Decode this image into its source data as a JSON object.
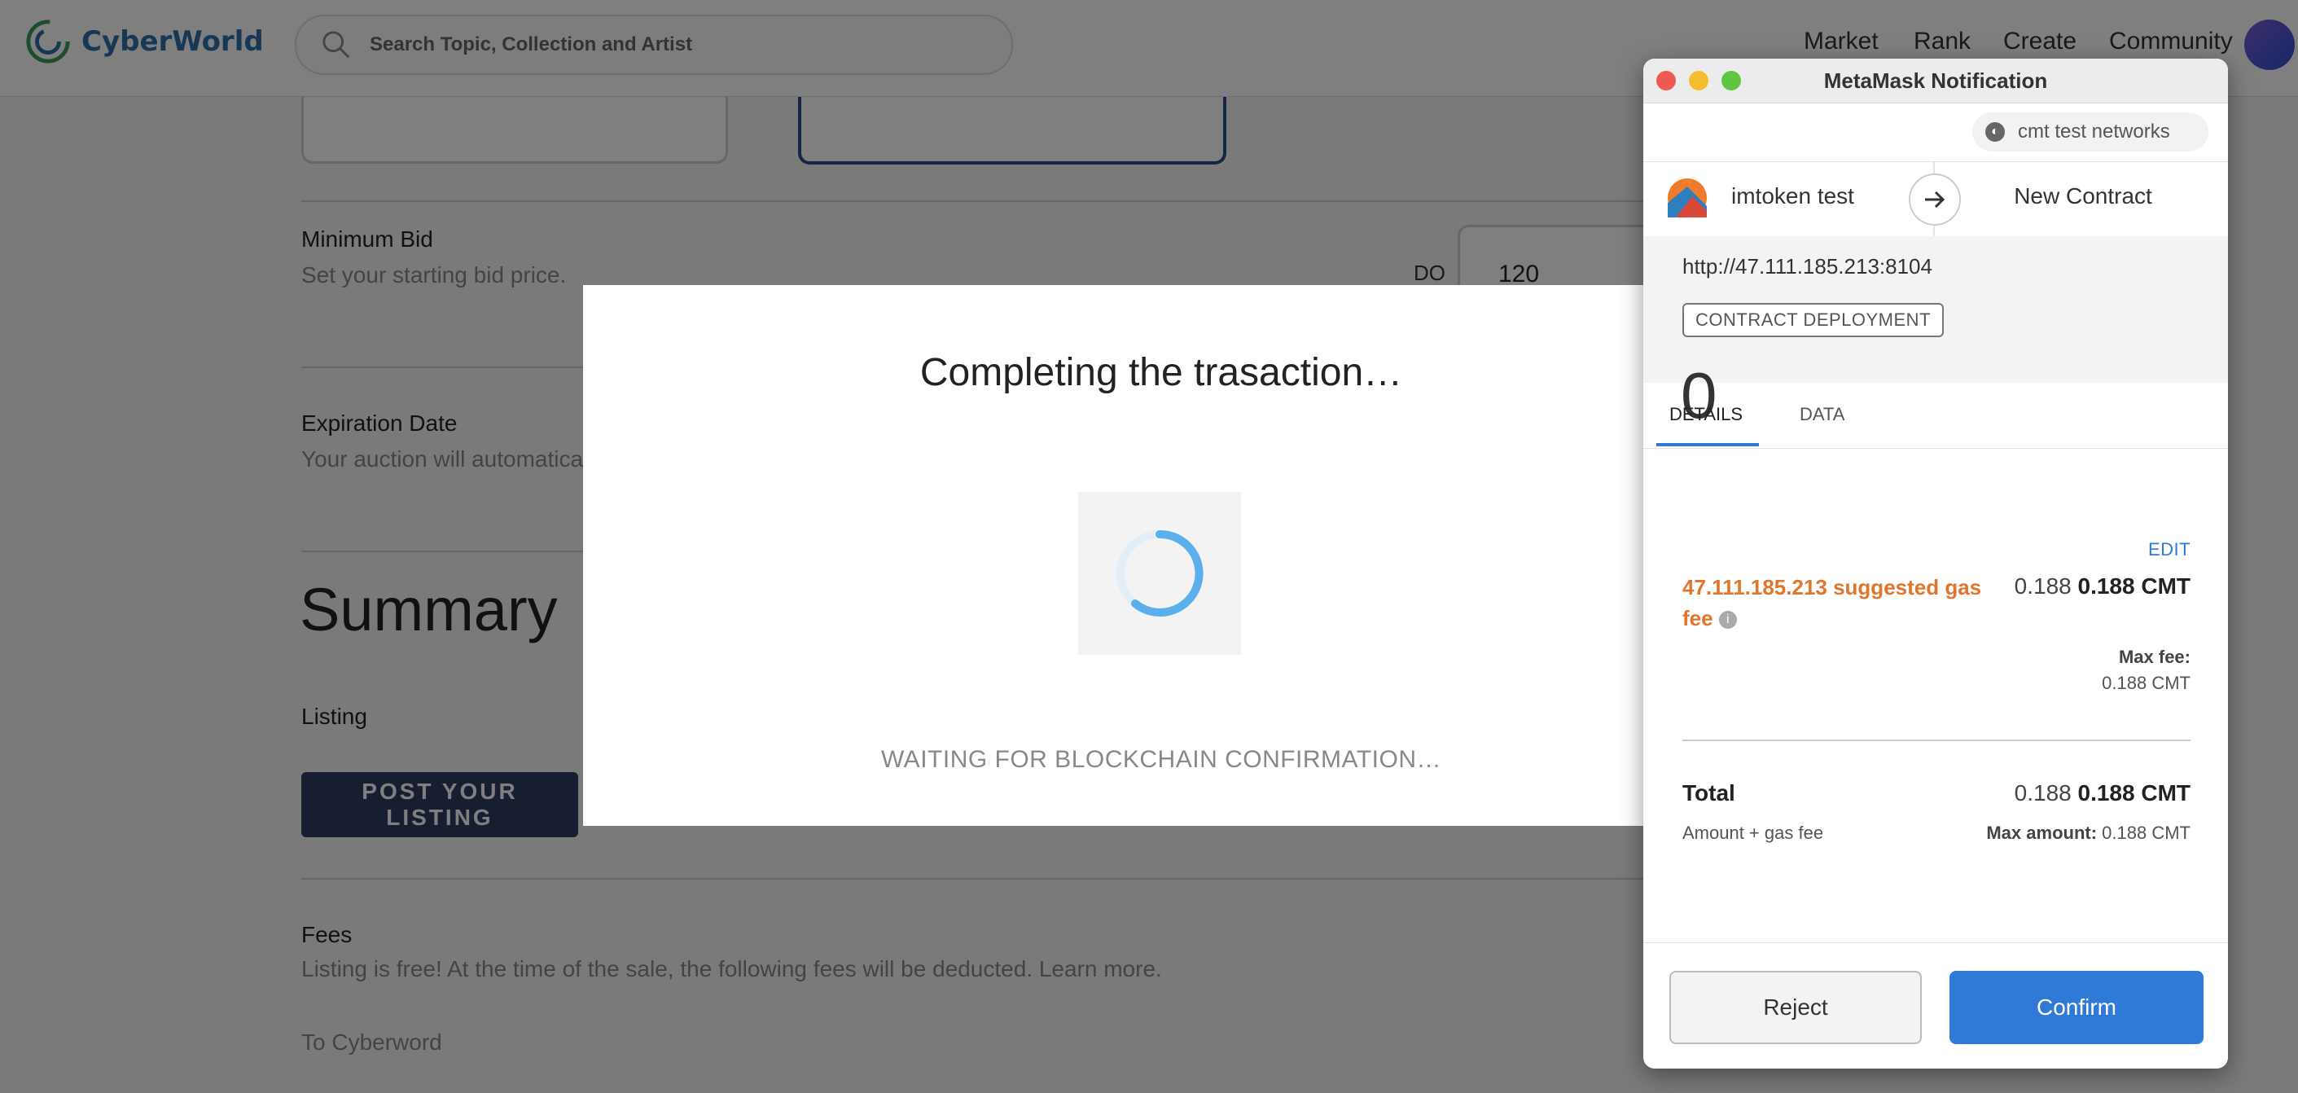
{
  "header": {
    "brand": "CyberWorld",
    "search_placeholder": "Search Topic, Collection and Artist",
    "nav": [
      "Market",
      "Rank",
      "Create",
      "Community"
    ]
  },
  "form": {
    "min_bid_label": "Minimum Bid",
    "min_bid_sub": "Set your starting bid price.",
    "currency": "DO",
    "bid_value": "120",
    "expiration_label": "Expiration Date",
    "expiration_sub": "Your auction will automatica",
    "summary_title": "Summary",
    "listing_label": "Listing",
    "post_button": "POST YOUR LISTING",
    "fees_label": "Fees",
    "fees_sub": "Listing is free! At the time of the sale, the following fees will be deducted. Learn more.",
    "to_label": "To Cyberword"
  },
  "modal": {
    "title": "Completing the trasaction…",
    "status": "WAITING FOR BLOCKCHAIN CONFIRMATION…"
  },
  "metamask": {
    "window_title": "MetaMask Notification",
    "network": "cmt test networks",
    "account": "imtoken test",
    "destination": "New Contract",
    "origin": "http://47.111.185.213:8104",
    "badge": "CONTRACT DEPLOYMENT",
    "amount": "0",
    "tabs": [
      "DETAILS",
      "DATA"
    ],
    "edit": "EDIT",
    "gas_label": "47.111.185.213 suggested gas fee",
    "gas_value": "0.188",
    "gas_value_bold": "0.188 CMT",
    "max_fee_label": "Max fee:",
    "max_fee_value": "0.188 CMT",
    "total_label": "Total",
    "total_value": "0.188",
    "total_value_bold": "0.188 CMT",
    "amount_gas_label": "Amount + gas fee",
    "max_amount_label": "Max amount:",
    "max_amount_value": "0.188 CMT",
    "reject": "Reject",
    "confirm": "Confirm"
  },
  "colors": {
    "accent_blue": "#2f7ad6",
    "gas_orange": "#e0752c",
    "post_button_bg": "#2e3c63"
  }
}
